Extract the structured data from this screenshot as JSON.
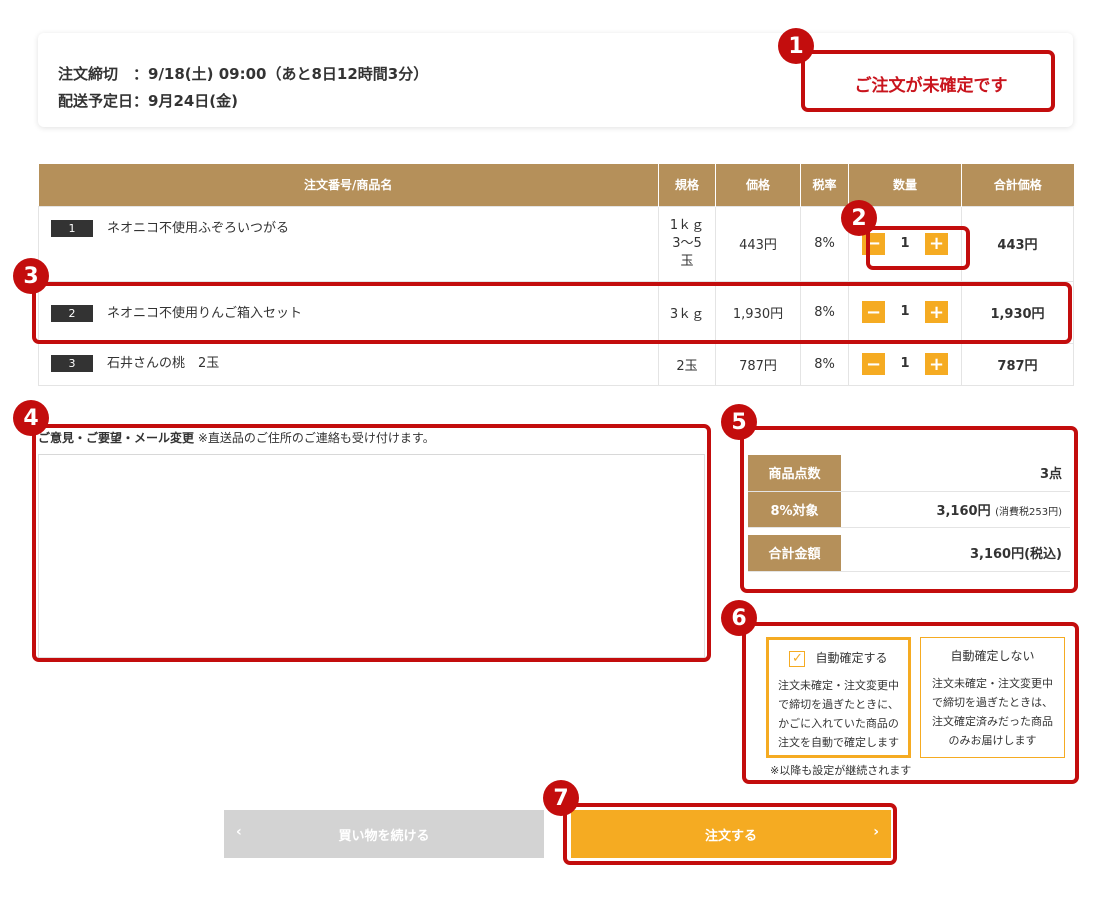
{
  "header": {
    "deadline": "注文締切　：9/18(土) 09:00（あと8日12時間3分）",
    "delivery": "配送予定日：9月24日(金)",
    "status": "ご注文が未確定です"
  },
  "table": {
    "headers": [
      "注文番号/商品名",
      "規格",
      "価格",
      "税率",
      "数量",
      "合計価格"
    ],
    "rows": [
      {
        "num": "1",
        "name": "ネオニコ不使用ふぞろいつがる",
        "spec_lines": [
          "1ｋｇ",
          "3～5",
          "玉"
        ],
        "price": "443円",
        "tax": "8%",
        "qty": "1",
        "total": "443円"
      },
      {
        "num": "2",
        "name": "ネオニコ不使用りんご箱入セット",
        "spec": "3ｋｇ",
        "price": "1,930円",
        "tax": "8%",
        "qty": "1",
        "total": "1,930円"
      },
      {
        "num": "3",
        "name": "石井さんの桃　2玉",
        "spec": "2玉",
        "price": "787円",
        "tax": "8%",
        "qty": "1",
        "total": "787円"
      }
    ],
    "minus": "−",
    "plus": "+"
  },
  "message": {
    "label_bold": "ご意見・ご要望・メール変更",
    "label_note": "※直送品のご住所のご連絡も受け付けます。",
    "value": ""
  },
  "summary": {
    "count_label": "商品点数",
    "count_value": "3点",
    "rate_label": "8%対象",
    "rate_value": "3,160円",
    "rate_tax_note": "(消費税253円)",
    "total_label": "合計金額",
    "total_value": "3,160円(税込)"
  },
  "auto_confirm": {
    "on_title": "自動確定する",
    "on_lines": [
      "注文未確定・注文変更中",
      "で締切を過ぎたときに、",
      "かごに入れていた商品の",
      "注文を自動で確定します"
    ],
    "off_title": "自動確定しない",
    "off_lines": [
      "注文未確定・注文変更中",
      "で締切を過ぎたときは、",
      "注文確定済みだった商品",
      "のみお届けします"
    ],
    "note": "※以降も設定が継続されます",
    "checked": true
  },
  "buttons": {
    "continue": "買い物を続ける",
    "continue_chev": "‹",
    "order": "注文する",
    "order_chev": "›"
  },
  "callouts": [
    "1",
    "2",
    "3",
    "4",
    "5",
    "6",
    "7"
  ]
}
